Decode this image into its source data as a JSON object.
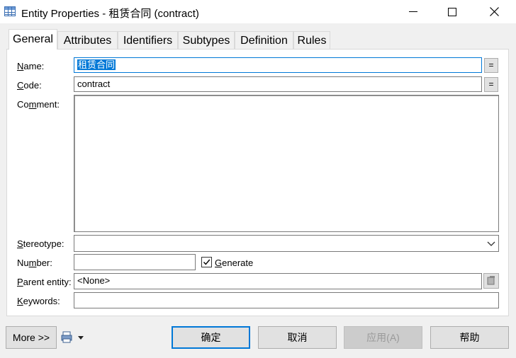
{
  "window": {
    "title": "Entity Properties - 租赁合同 (contract)"
  },
  "tabs": [
    {
      "label": "General",
      "active": true
    },
    {
      "label": "Attributes"
    },
    {
      "label": "Identifiers"
    },
    {
      "label": "Subtypes"
    },
    {
      "label": "Definition"
    },
    {
      "label": "Rules"
    }
  ],
  "form": {
    "name": {
      "label_key": "N",
      "label_rest": "ame:",
      "value": "租赁合同",
      "button": "="
    },
    "code": {
      "label_key": "C",
      "label_rest": "ode:",
      "value": "contract",
      "button": "="
    },
    "comment": {
      "label_pre": "Co",
      "label_key": "m",
      "label_rest": "ment:",
      "value": ""
    },
    "stereotype": {
      "label_key": "S",
      "label_rest": "tereotype:",
      "value": ""
    },
    "number": {
      "label_pre": "Nu",
      "label_key": "m",
      "label_rest": "ber:",
      "value": ""
    },
    "generate": {
      "label_key": "G",
      "label_rest": "enerate",
      "checked": true
    },
    "parent_entity": {
      "label_key": "P",
      "label_rest": "arent entity:",
      "value": "<None>"
    },
    "keywords": {
      "label_key": "K",
      "label_rest": "eywords:",
      "value": ""
    }
  },
  "footer": {
    "more_label": "More >>",
    "ok_label": "确定",
    "cancel_label": "取消",
    "apply_label": "应用(A)",
    "help_label": "帮助"
  },
  "icons": {
    "title": "table-icon",
    "minimize": "minimize-icon",
    "maximize": "maximize-icon",
    "close": "close-icon",
    "printer": "printer-icon",
    "dropdown": "chevron-down-icon"
  },
  "colors": {
    "accent": "#0078d7",
    "window_bg": "#f0f0f0"
  }
}
